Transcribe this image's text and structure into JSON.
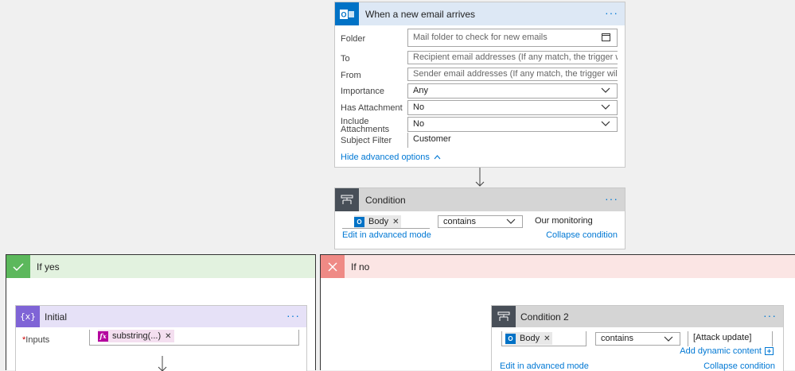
{
  "trigger": {
    "title": "When a new email arrives",
    "fields": {
      "folder": {
        "label": "Folder",
        "placeholder": "Mail folder to check for new emails"
      },
      "to": {
        "label": "To",
        "placeholder": "Recipient email addresses (If any match, the trigger will run)"
      },
      "from": {
        "label": "From",
        "placeholder": "Sender email addresses (If any match, the trigger will run)"
      },
      "importance": {
        "label": "Importance",
        "value": "Any"
      },
      "has_attachment": {
        "label": "Has Attachment",
        "value": "No"
      },
      "include_attachments": {
        "label_line1": "Include",
        "label_line2": "Attachments",
        "value": "No"
      },
      "subject_filter": {
        "label": "Subject Filter",
        "value": "Customer"
      }
    },
    "hide_advanced": "Hide advanced options"
  },
  "condition": {
    "title": "Condition",
    "token": "Body",
    "operator": "contains",
    "value": "Our monitoring",
    "edit_advanced": "Edit in advanced mode",
    "collapse": "Collapse condition"
  },
  "if_yes": {
    "title": "If yes",
    "initial": {
      "title": "Initial",
      "inputs_label": "Inputs",
      "required_mark": "*",
      "token": "substring(...)"
    }
  },
  "if_no": {
    "title": "If no",
    "condition2": {
      "title": "Condition 2",
      "token": "Body",
      "operator": "contains",
      "value": "[Attack update]",
      "add_dynamic": "Add dynamic content",
      "edit_advanced": "Edit in advanced mode",
      "collapse": "Collapse condition"
    }
  },
  "colors": {
    "outlook_blue": "#0072c6",
    "trigger_header": "#dde8f5",
    "condition_header": "#d5d5d5",
    "condition_icon": "#484f58",
    "yes_header": "#e2f2df",
    "yes_icon": "#5cb85c",
    "no_header": "#fbe5e4",
    "no_icon": "#ef8a85",
    "variable_header": "#e6e1f7",
    "variable_icon": "#7f64d6",
    "expression_icon": "#b4009e",
    "link": "#0078d4"
  },
  "icons": {
    "outlook": "outlook-icon",
    "condition": "condition-icon",
    "yes": "check-icon",
    "no": "x-icon",
    "variable": "variable-icon",
    "expression": "fx-icon"
  }
}
